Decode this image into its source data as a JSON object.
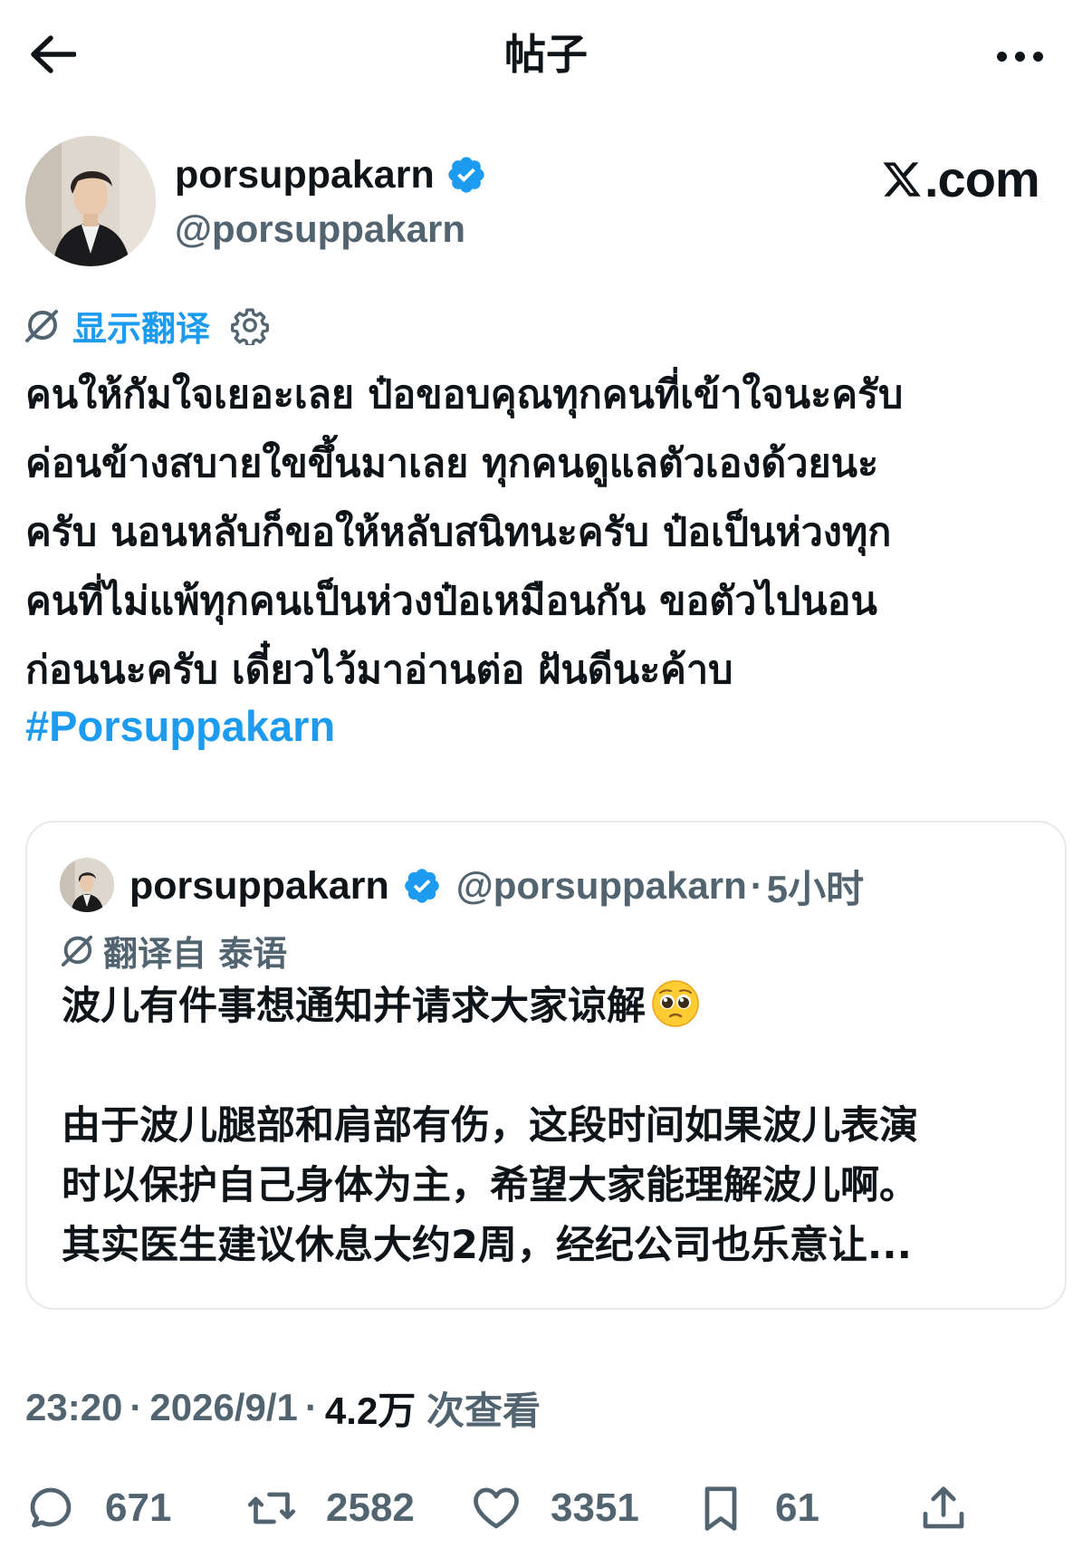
{
  "header": {
    "title": "帖子"
  },
  "author": {
    "name": "porsuppakarn",
    "handle": "@porsuppakarn",
    "brand": ".com"
  },
  "translation": {
    "show_label": "显示翻译"
  },
  "tweet": {
    "lines": [
      "คนให้กัมใจเยอะเลย ป๋อขอบคุณทุกคนที่เข้าใจนะครับ",
      "ค่อนข้างสบายใขขึ้นมาเลย ทุกคนดูแลตัวเองด้วยนะ",
      "ครับ นอนหลับก็ขอให้หลับสนิทนะครับ ป๋อเป็นห่วงทุก",
      "คนที่ไม่แพ้ทุกคนเป็นห่วงป๋อเหมือนกัน ขอตัวไปนอน",
      "ก่อนนะครับ เดี๋ยวไว้มาอ่านต่อ ฝันดีนะค้าบ"
    ],
    "hashtag": "#Porsuppakarn"
  },
  "quote": {
    "name": "porsuppakarn",
    "handle": "@porsuppakarn",
    "dot": "·",
    "time": "5小时",
    "translated_label": "翻译自 泰语",
    "line1": "波儿有件事想通知并请求大家谅解",
    "line2": "由于波儿腿部和肩部有伤，这段时间如果波儿表演",
    "line3": "时以保护自己身体为主，希望大家能理解波儿啊。",
    "line4": "其实医生建议休息大约2周，经纪公司也乐意让..."
  },
  "meta": {
    "time": "23:20",
    "sep1": "·",
    "date": "2026/9/1",
    "sep2": "·",
    "views": "4.2万",
    "views_label": " 次查看"
  },
  "actions": {
    "replies": "671",
    "reposts": "2582",
    "likes": "3351",
    "bookmarks": "61"
  },
  "colors": {
    "accent": "#1d9bf0",
    "text": "#0f1419",
    "secondary": "#536471",
    "border": "#e6e9ec"
  },
  "icons": [
    "back-arrow-icon",
    "more-icon",
    "verified-badge-icon",
    "x-logo-icon",
    "translate-icon",
    "gear-icon",
    "pleading-face-emoji",
    "reply-icon",
    "repost-icon",
    "like-icon",
    "bookmark-icon",
    "share-icon"
  ]
}
